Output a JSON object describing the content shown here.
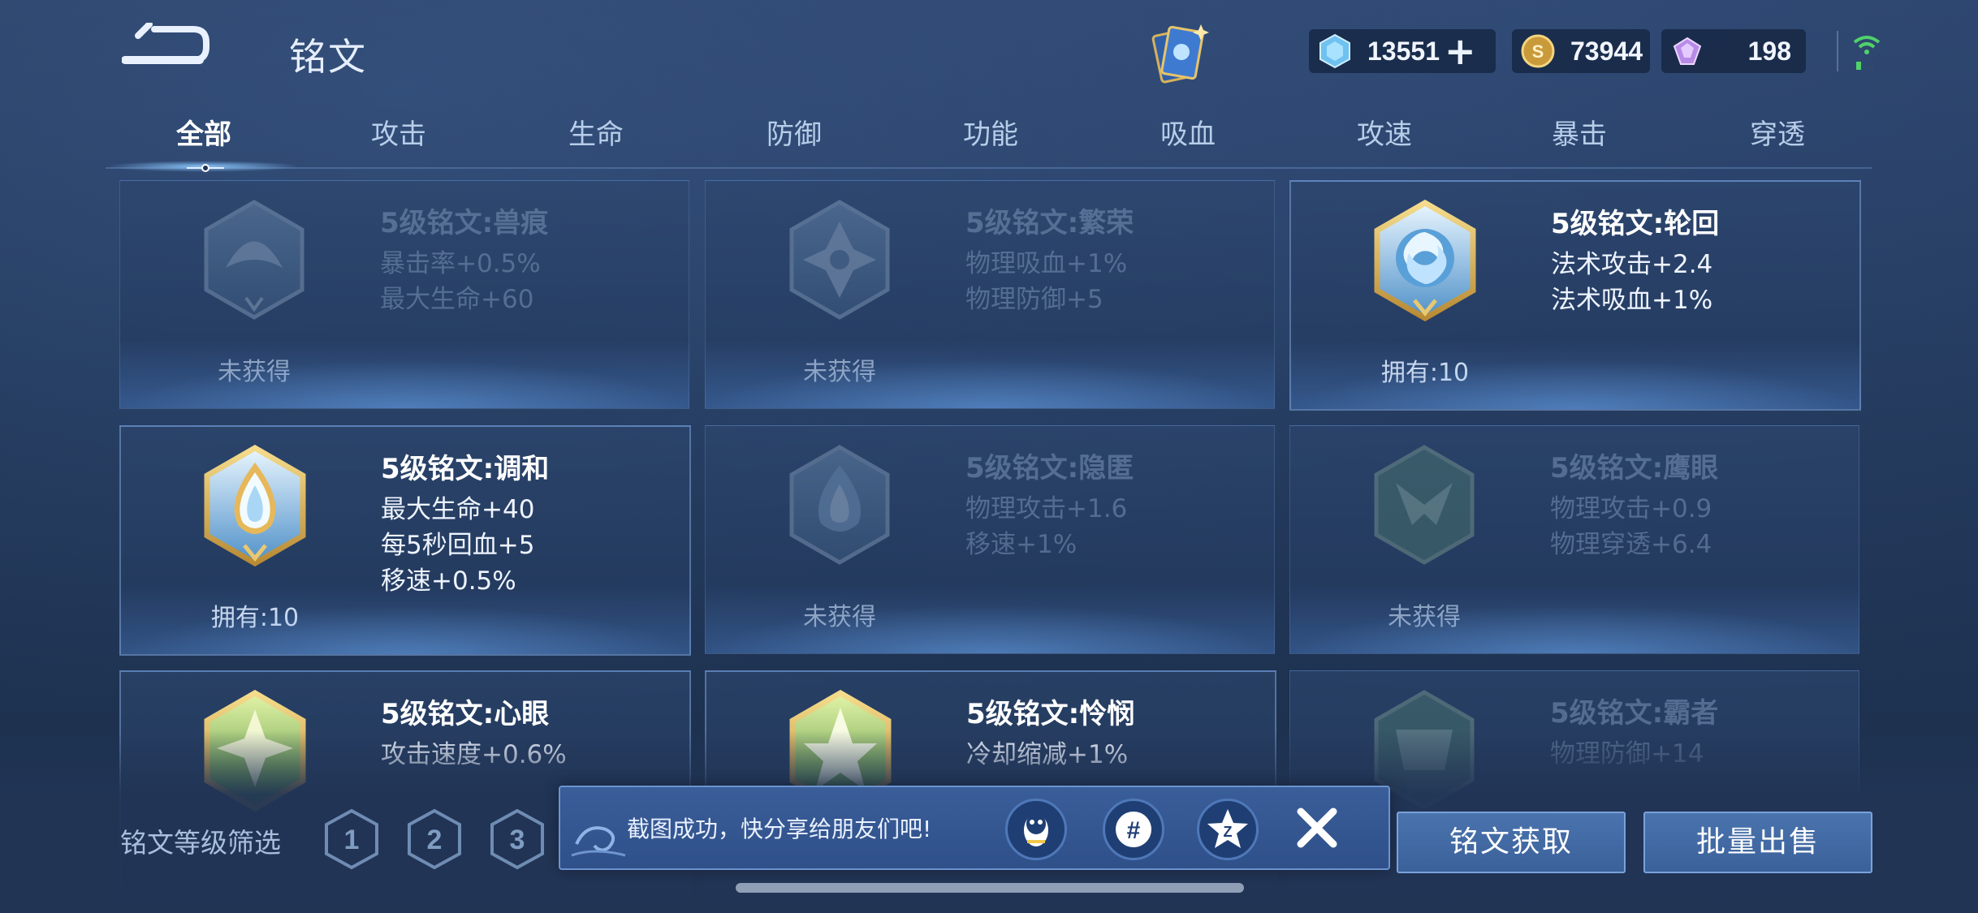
{
  "header": {
    "title": "铭文",
    "currencies": {
      "diamond": "13551",
      "gold": "73944",
      "gem": "198"
    }
  },
  "tabs": [
    {
      "label": "全部",
      "active": true
    },
    {
      "label": "攻击"
    },
    {
      "label": "生命"
    },
    {
      "label": "防御"
    },
    {
      "label": "功能"
    },
    {
      "label": "吸血"
    },
    {
      "label": "攻速"
    },
    {
      "label": "暴击"
    },
    {
      "label": "穿透"
    }
  ],
  "cards": [
    {
      "name": "5级铭文:兽痕",
      "stats": [
        "暴击率+0.5%",
        "最大生命+60"
      ],
      "status": "未获得",
      "owned": false
    },
    {
      "name": "5级铭文:繁荣",
      "stats": [
        "物理吸血+1%",
        "物理防御+5"
      ],
      "status": "未获得",
      "owned": false
    },
    {
      "name": "5级铭文:轮回",
      "stats": [
        "法术攻击+2.4",
        "法术吸血+1%"
      ],
      "status": "拥有:10",
      "owned": true
    },
    {
      "name": "5级铭文:调和",
      "stats": [
        "最大生命+40",
        "每5秒回血+5",
        "移速+0.5%"
      ],
      "status": "拥有:10",
      "owned": true
    },
    {
      "name": "5级铭文:隐匿",
      "stats": [
        "物理攻击+1.6",
        "移速+1%"
      ],
      "status": "未获得",
      "owned": false
    },
    {
      "name": "5级铭文:鹰眼",
      "stats": [
        "物理攻击+0.9",
        "物理穿透+6.4"
      ],
      "status": "未获得",
      "owned": false
    },
    {
      "name": "5级铭文:心眼",
      "stats": [
        "攻击速度+0.6%"
      ],
      "status": "",
      "owned": true
    },
    {
      "name": "5级铭文:怜悯",
      "stats": [
        "冷却缩减+1%"
      ],
      "status": "",
      "owned": true
    },
    {
      "name": "5级铭文:霸者",
      "stats": [
        "物理防御+14"
      ],
      "status": "",
      "owned": false
    }
  ],
  "bottom": {
    "filter_label": "铭文等级筛选",
    "levels": [
      "1",
      "2",
      "3"
    ],
    "toast_message": "截图成功，快分享给朋友们吧!",
    "get_button": "铭文获取",
    "sell_button": "批量出售"
  },
  "colors": {
    "background": "#213656",
    "accent": "#7aa2db",
    "gold": "#d9b25a"
  }
}
